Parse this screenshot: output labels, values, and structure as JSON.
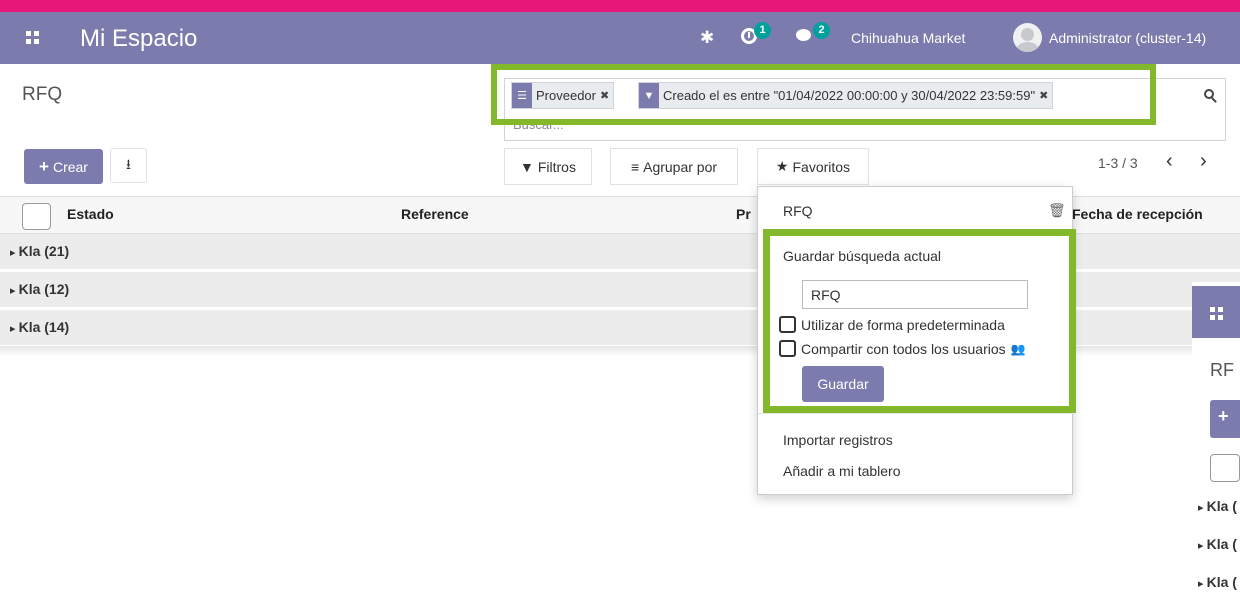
{
  "navbar": {
    "title": "Mi Espacio",
    "activity_count": "1",
    "messages_count": "2",
    "company": "Chihuahua Market",
    "user": "Administrator (cluster-14)"
  },
  "breadcrumb": "RFQ",
  "search": {
    "placeholder": "Buscar...",
    "facets": [
      {
        "icon": "group-by-icon",
        "label": "Proveedor"
      },
      {
        "icon": "filter-icon",
        "label": "Creado el es entre \"01/04/2022 00:00:00 y 30/04/2022 23:59:59\""
      }
    ]
  },
  "toolbar": {
    "create_label": "Crear",
    "filters_label": "Filtros",
    "group_by_label": "Agrupar por",
    "favorites_label": "Favoritos",
    "pager": "1-3 / 3"
  },
  "table": {
    "columns": [
      "Estado",
      "Reference",
      "Pr",
      "Fecha de recepción"
    ],
    "groups": [
      "Kla (21)",
      "Kla (12)",
      "Kla (14)"
    ]
  },
  "favorites_menu": {
    "saved_filter": "RFQ",
    "save_current_label": "Guardar búsqueda actual",
    "save_name_value": "RFQ",
    "default_label": "Utilizar de forma predeterminada",
    "share_label": "Compartir con todos los usuarios",
    "save_button": "Guardar",
    "import_label": "Importar registros",
    "dashboard_label": "Añadir a mi tablero"
  },
  "ghost_window": {
    "breadcrumb": "RF",
    "rows": [
      "Kla (",
      "Kla (",
      "Kla ("
    ]
  },
  "colors": {
    "brand": "#7c7bad",
    "top_strip": "#e7187a",
    "highlight": "#84b82b",
    "badge": "#00a09d"
  }
}
